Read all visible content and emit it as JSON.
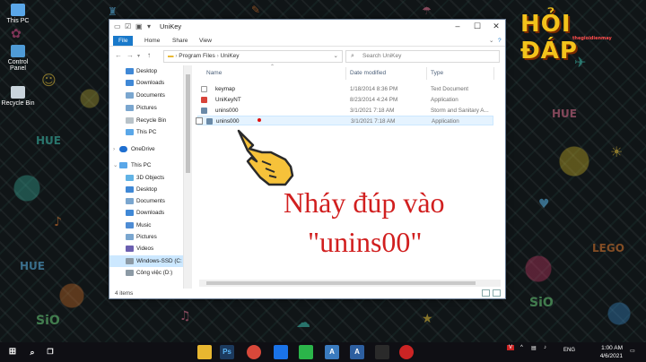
{
  "desktop": {
    "icons": [
      {
        "label": "This PC",
        "icon": "this-pc-icon",
        "color": "#5aa7e8"
      },
      {
        "label": "Control Panel",
        "icon": "control-panel-icon",
        "color": "#4f9bd6"
      },
      {
        "label": "Recycle Bin",
        "icon": "recycle-bin-icon",
        "color": "#c9d4dc"
      }
    ],
    "logo": {
      "text": "HỎI ĐÁP",
      "tagline": "thegioidienmay"
    }
  },
  "window": {
    "title": "UniKey",
    "ribbon_tabs": [
      "File",
      "Home",
      "Share",
      "View"
    ],
    "address_parts": [
      "Program Files",
      "UniKey"
    ],
    "search_placeholder": "Search UniKey",
    "nav_items": [
      {
        "label": "Desktop",
        "icon": "desktop-folder-icon",
        "color": "#3f88d6",
        "level": 1
      },
      {
        "label": "Downloads",
        "icon": "downloads-folder-icon",
        "color": "#3f88d6",
        "level": 1
      },
      {
        "label": "Documents",
        "icon": "documents-folder-icon",
        "color": "#7aa6cf",
        "level": 1
      },
      {
        "label": "Pictures",
        "icon": "pictures-folder-icon",
        "color": "#7aa6cf",
        "level": 1
      },
      {
        "label": "Recycle Bin",
        "icon": "recycle-bin-icon",
        "color": "#b8c2c8",
        "level": 1
      },
      {
        "label": "This PC",
        "icon": "this-pc-icon",
        "color": "#5aa7e8",
        "level": 1
      },
      {
        "label": "OneDrive",
        "icon": "onedrive-icon",
        "color": "#1f6fd0",
        "level": 0
      },
      {
        "label": "This PC",
        "icon": "this-pc-icon",
        "color": "#5aa7e8",
        "level": 0
      },
      {
        "label": "3D Objects",
        "icon": "3d-objects-icon",
        "color": "#61b3e5",
        "level": 1
      },
      {
        "label": "Desktop",
        "icon": "desktop-folder-icon",
        "color": "#3f88d6",
        "level": 1
      },
      {
        "label": "Documents",
        "icon": "documents-folder-icon",
        "color": "#7aa6cf",
        "level": 1
      },
      {
        "label": "Downloads",
        "icon": "downloads-folder-icon",
        "color": "#3f88d6",
        "level": 1
      },
      {
        "label": "Music",
        "icon": "music-folder-icon",
        "color": "#4e8cd4",
        "level": 1
      },
      {
        "label": "Pictures",
        "icon": "pictures-folder-icon",
        "color": "#7aa6cf",
        "level": 1
      },
      {
        "label": "Videos",
        "icon": "videos-folder-icon",
        "color": "#6b5fb0",
        "level": 1
      },
      {
        "label": "Windows-SSD (C:",
        "icon": "drive-icon",
        "color": "#8c9aa5",
        "level": 1,
        "selected": true
      },
      {
        "label": "Công việc (D:)",
        "icon": "drive-icon",
        "color": "#8c9aa5",
        "level": 1
      }
    ],
    "columns": [
      "Name",
      "Date modified",
      "Type"
    ],
    "files": [
      {
        "name": "keymap",
        "date": "1/18/2014 8:36 PM",
        "type": "Text Document",
        "icon": "text-file-icon",
        "color": "#ffffff"
      },
      {
        "name": "UniKeyNT",
        "date": "8/23/2014 4:24 PM",
        "type": "Application",
        "icon": "unikey-app-icon",
        "color": "#d8443a"
      },
      {
        "name": "unins000",
        "date": "3/1/2021 7:18 AM",
        "type": "Storm and Sanitary A...",
        "icon": "data-file-icon",
        "color": "#6a8aa8"
      },
      {
        "name": "unins000",
        "date": "3/1/2021 7:18 AM",
        "type": "Application",
        "icon": "installer-app-icon",
        "color": "#6a8aa8"
      }
    ],
    "status": "4 items"
  },
  "annotation": {
    "line1": "Nháy đúp vào",
    "line2": "\"unins00\""
  },
  "taskbar": {
    "apps": [
      {
        "icon": "file-explorer-icon",
        "color": "#e8b730"
      },
      {
        "icon": "photoshop-icon",
        "color": "#1c3a5e",
        "label": "Ps"
      },
      {
        "icon": "chrome-icon",
        "color": "#d8483a"
      },
      {
        "icon": "zalo-icon",
        "color": "#1a73e8"
      },
      {
        "icon": "line-icon",
        "color": "#2bb54a"
      },
      {
        "icon": "app-a-icon",
        "color": "#3a7bbf",
        "label": "A"
      },
      {
        "icon": "app-a2-icon",
        "color": "#2d5fa0",
        "label": "A"
      },
      {
        "icon": "recording-icon",
        "color": "#2a2a2a"
      },
      {
        "icon": "record-icon",
        "color": "#cc2424"
      }
    ],
    "lang": "ENG",
    "time": "1:00 AM",
    "date": "4/6/2021"
  }
}
